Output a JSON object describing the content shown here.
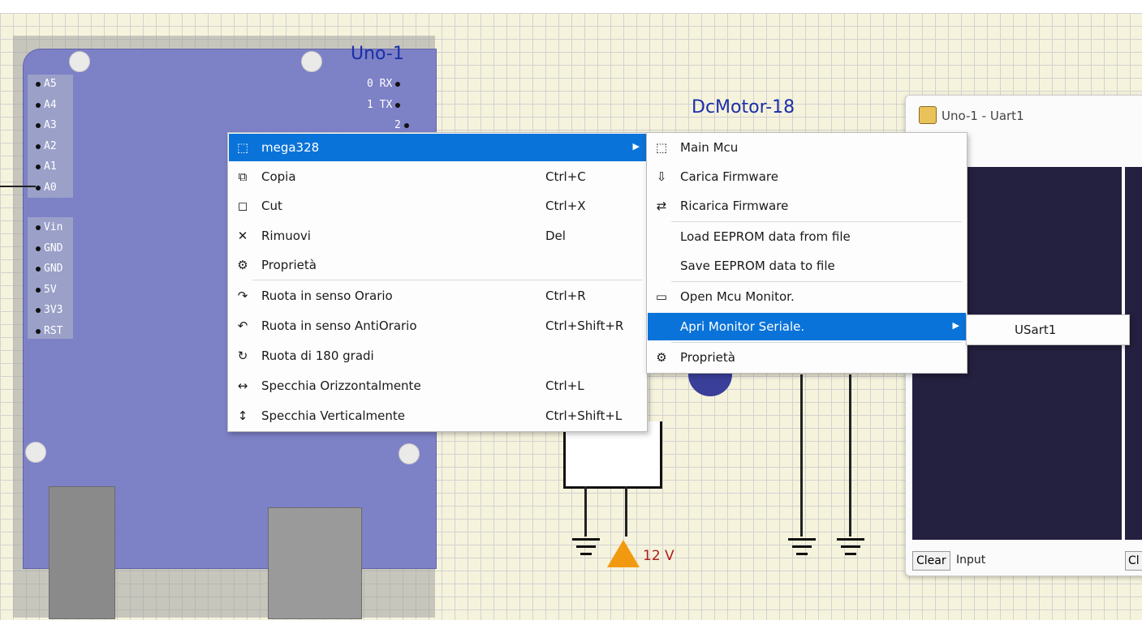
{
  "board": {
    "title": "Uno-1",
    "left_pins": [
      "A5",
      "A4",
      "A3",
      "A2",
      "A1",
      "A0",
      "Vin",
      "GND",
      "GND",
      "5V",
      "3V3",
      "RST"
    ],
    "right_pins": [
      "0 RX",
      "1 TX",
      "2"
    ]
  },
  "motor": {
    "label": "DcMotor-18"
  },
  "power": {
    "label": "12 V"
  },
  "uart_window": {
    "title": "Uno-1 - Uart1",
    "clear_label": "Clear",
    "input_label": "Input",
    "partial_label": "Cl"
  },
  "context_menu": {
    "items": [
      {
        "icon": "chip-icon",
        "glyph": "⬚",
        "label": "mega328",
        "shortcut": "",
        "submenu": true
      },
      {
        "icon": "copy-icon",
        "glyph": "⧉",
        "label": "Copia",
        "shortcut": "Ctrl+C"
      },
      {
        "icon": "cut-icon",
        "glyph": "◻",
        "label": "Cut",
        "shortcut": "Ctrl+X"
      },
      {
        "icon": "remove-icon",
        "glyph": "✕",
        "label": "Rimuovi",
        "shortcut": "Del"
      },
      {
        "icon": "properties-icon",
        "glyph": "⚙",
        "label": "Proprietà",
        "shortcut": ""
      },
      {
        "icon": "rotate-cw-icon",
        "glyph": "↷",
        "label": "Ruota in senso Orario",
        "shortcut": "Ctrl+R"
      },
      {
        "icon": "rotate-ccw-icon",
        "glyph": "↶",
        "label": "Ruota in senso AntiOrario",
        "shortcut": "Ctrl+Shift+R"
      },
      {
        "icon": "rotate-180-icon",
        "glyph": "↻",
        "label": "Ruota di 180 gradi",
        "shortcut": ""
      },
      {
        "icon": "flip-horizontal-icon",
        "glyph": "↔",
        "label": "Specchia Orizzontalmente",
        "shortcut": "Ctrl+L"
      },
      {
        "icon": "flip-vertical-icon",
        "glyph": "↕",
        "label": "Specchia Verticalmente",
        "shortcut": "Ctrl+Shift+L"
      }
    ]
  },
  "mcu_submenu": {
    "items": [
      {
        "icon": "chip-icon",
        "glyph": "⬚",
        "label": "Main Mcu"
      },
      {
        "icon": "load-firmware-icon",
        "glyph": "⇩",
        "label": "Carica Firmware"
      },
      {
        "icon": "reload-firmware-icon",
        "glyph": "⇄",
        "label": "Ricarica Firmware"
      },
      {
        "icon": "",
        "glyph": "",
        "label": "Load EEPROM data from file"
      },
      {
        "icon": "",
        "glyph": "",
        "label": "Save EEPROM data to file"
      },
      {
        "icon": "monitor-icon",
        "glyph": "▭",
        "label": "Open Mcu Monitor."
      },
      {
        "icon": "",
        "glyph": "",
        "label": "Apri Monitor Seriale.",
        "submenu": true
      },
      {
        "icon": "properties-icon",
        "glyph": "⚙",
        "label": "Proprietà"
      }
    ]
  },
  "serial_submenu": {
    "items": [
      {
        "label": "USart1"
      }
    ]
  },
  "colors": {
    "highlight": "#0a73d9",
    "board": "#7a7ec7",
    "grid": "#f6f3dd"
  }
}
